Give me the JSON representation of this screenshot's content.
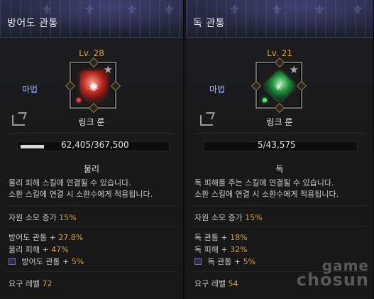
{
  "panels": [
    {
      "title": "방어도 관통",
      "level": "Lv. 28",
      "category": "마법",
      "rune_name": "링크 룬",
      "progress_text": "62,405/367,500",
      "progress_fraction": 0.17,
      "element": "물리",
      "description": [
        "물리 피해 스킬에 연결될 수 있습니다.",
        "소환 스킬에 연결 시 소환수에게 적용됩니다."
      ],
      "resource_label": "자원 소모 증가",
      "resource_value": "15%",
      "stat1_label": "방어도 관통 +",
      "stat1_value": "27.8%",
      "stat2_label": "물리 피해 +",
      "stat2_value": "47%",
      "stat3_label": "방어도 관통 +",
      "stat3_value": "5%",
      "req_label": "요구 레벨",
      "req_value": "72",
      "rune_color": "#c0291f",
      "icon": "shield-rune-icon"
    },
    {
      "title": "독 관통",
      "level": "Lv. 21",
      "category": "마법",
      "rune_name": "링크 룬",
      "progress_text": "5/43,575",
      "progress_fraction": 0.0,
      "element": "독",
      "description": [
        "독 피해를 주는 스킬에 연결될 수 있습니다.",
        "소환 스킬에 연결 시 소환수에게 적용됩니다."
      ],
      "resource_label": "자원 소모 증가",
      "resource_value": "15%",
      "stat1_label": "독 관통 +",
      "stat1_value": "18%",
      "stat2_label": "독 피해 +",
      "stat2_value": "32%",
      "stat3_label": "독 관통 +",
      "stat3_value": "5%",
      "req_label": "요구 레벨",
      "req_value": "54",
      "rune_color": "#2aa04b",
      "icon": "diamond-rune-icon"
    }
  ],
  "watermark": {
    "line1": "game",
    "line2": "chosun"
  }
}
